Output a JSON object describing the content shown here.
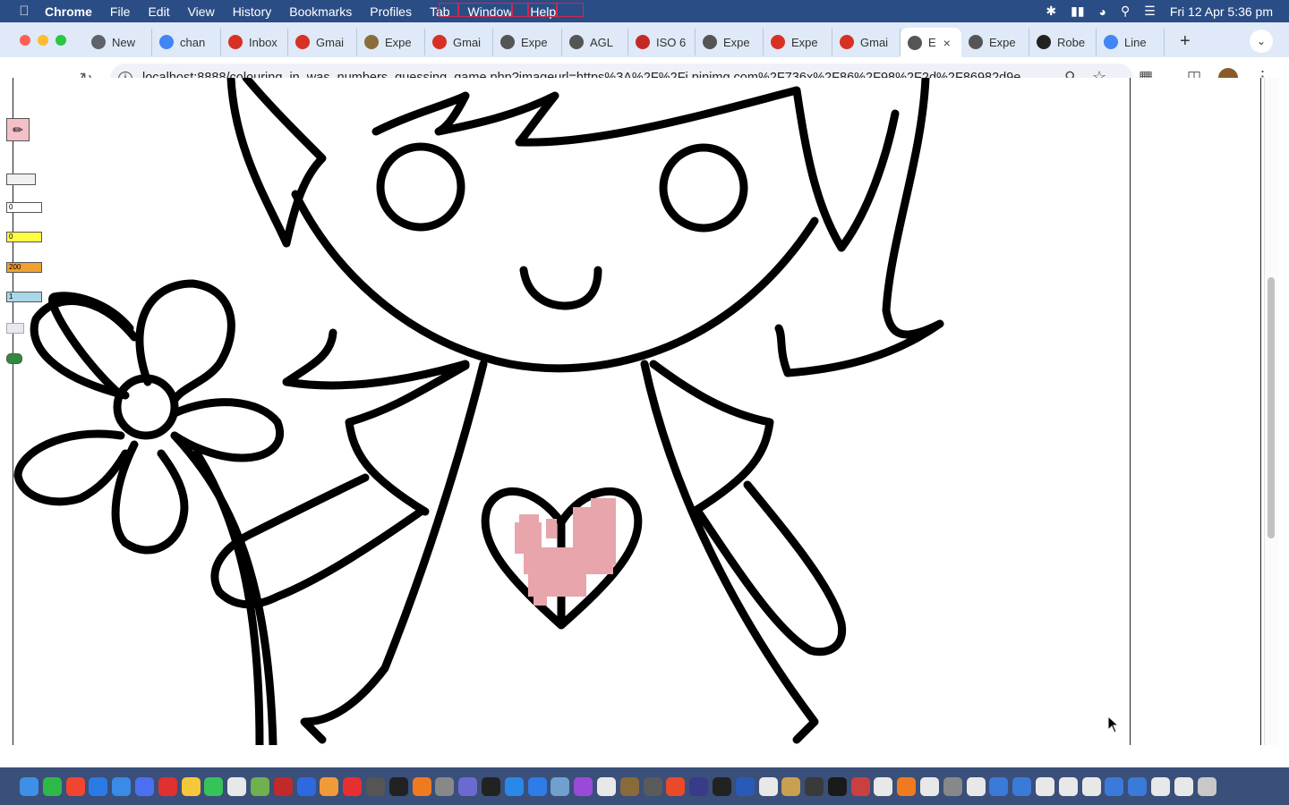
{
  "menubar": {
    "app_name": "Chrome",
    "menus": [
      "File",
      "Edit",
      "View",
      "History",
      "Bookmarks",
      "Profiles",
      "Tab",
      "Window",
      "Help"
    ],
    "clock": "Fri 12 Apr  5:36 pm"
  },
  "tabs": [
    {
      "label": "New",
      "icon": "chrome-icon",
      "color": "#5f6368"
    },
    {
      "label": "chan",
      "icon": "google-icon",
      "color": "#4285f4"
    },
    {
      "label": "Inbox",
      "icon": "gmail-icon",
      "color": "#d93025"
    },
    {
      "label": "Gmai",
      "icon": "gmail-icon",
      "color": "#d93025"
    },
    {
      "label": "Expe",
      "icon": "quill-icon",
      "color": "#8a6d3b"
    },
    {
      "label": "Gmai",
      "icon": "gmail-icon",
      "color": "#d93025"
    },
    {
      "label": "Expe",
      "icon": "site-icon",
      "color": "#555555"
    },
    {
      "label": "AGL",
      "icon": "globe-icon",
      "color": "#555555"
    },
    {
      "label": "ISO 6",
      "icon": "iso-icon",
      "color": "#c62828"
    },
    {
      "label": "Expe",
      "icon": "site-icon",
      "color": "#555555"
    },
    {
      "label": "Expe",
      "icon": "gmail-icon",
      "color": "#d93025"
    },
    {
      "label": "Gmai",
      "icon": "gmail-icon",
      "color": "#d93025"
    },
    {
      "label": "E",
      "icon": "site-icon",
      "color": "#555555",
      "active": true
    },
    {
      "label": "Expe",
      "icon": "site-icon",
      "color": "#555555"
    },
    {
      "label": "Robe",
      "icon": "dark-site-icon",
      "color": "#222222"
    },
    {
      "label": "Line",
      "icon": "google-icon",
      "color": "#4285f4"
    }
  ],
  "toolbar": {
    "url": "localhost:8888/colouring_in_was_numbers_guessing_game.php?imageurl=https%3A%2F%2Fi.pinimg.com%2F736x%2F86%2F98%2F2d%2F86982d9e..."
  },
  "tools": {
    "field_1": "0",
    "field_2": "0",
    "field_3": "200",
    "field_4": "1"
  },
  "colors": {
    "heart_fill": "#e8a5ac",
    "field_yellow": "#ffff44",
    "field_orange": "#f0a030",
    "field_blue": "#a8d8e8",
    "pencil_bg": "#f4c0c8"
  }
}
